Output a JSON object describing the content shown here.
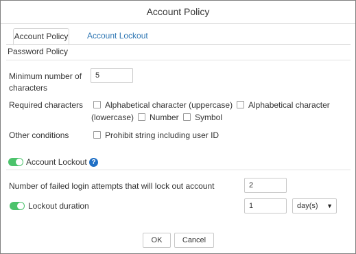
{
  "dialog": {
    "title": "Account Policy"
  },
  "tabs": [
    {
      "label": "Account Policy",
      "active": true
    },
    {
      "label": "Account Lockout",
      "active": false
    }
  ],
  "password_policy": {
    "section_title": "Password Policy",
    "min_chars_label_line1": "Minimum number of",
    "min_chars_label_line2": "characters",
    "min_chars_value": "5",
    "required_label": "Required characters",
    "required_options": {
      "uppercase": "Alphabetical character (uppercase)",
      "lowercase_part1": "Alphabetical character",
      "lowercase_part2": "(lowercase)",
      "number": "Number",
      "symbol": "Symbol"
    },
    "other_label": "Other conditions",
    "other_option": "Prohibit string including user ID"
  },
  "account_lockout": {
    "toggle_label": "Account Lockout",
    "help_glyph": "?",
    "enabled": true,
    "failed_attempts_label": "Number of failed login attempts that will lock out account",
    "failed_attempts_value": "2",
    "duration_toggle_label": "Lockout duration",
    "duration_enabled": true,
    "duration_value": "1",
    "duration_unit": "day(s)"
  },
  "footer": {
    "ok_label": "OK",
    "cancel_label": "Cancel"
  },
  "colors": {
    "accent_green": "#4cc36c",
    "link_blue": "#3178b4",
    "help_blue": "#1f6fc5"
  },
  "icons": {
    "help": "question-circle-icon",
    "dropdown": "caret-down-icon"
  }
}
